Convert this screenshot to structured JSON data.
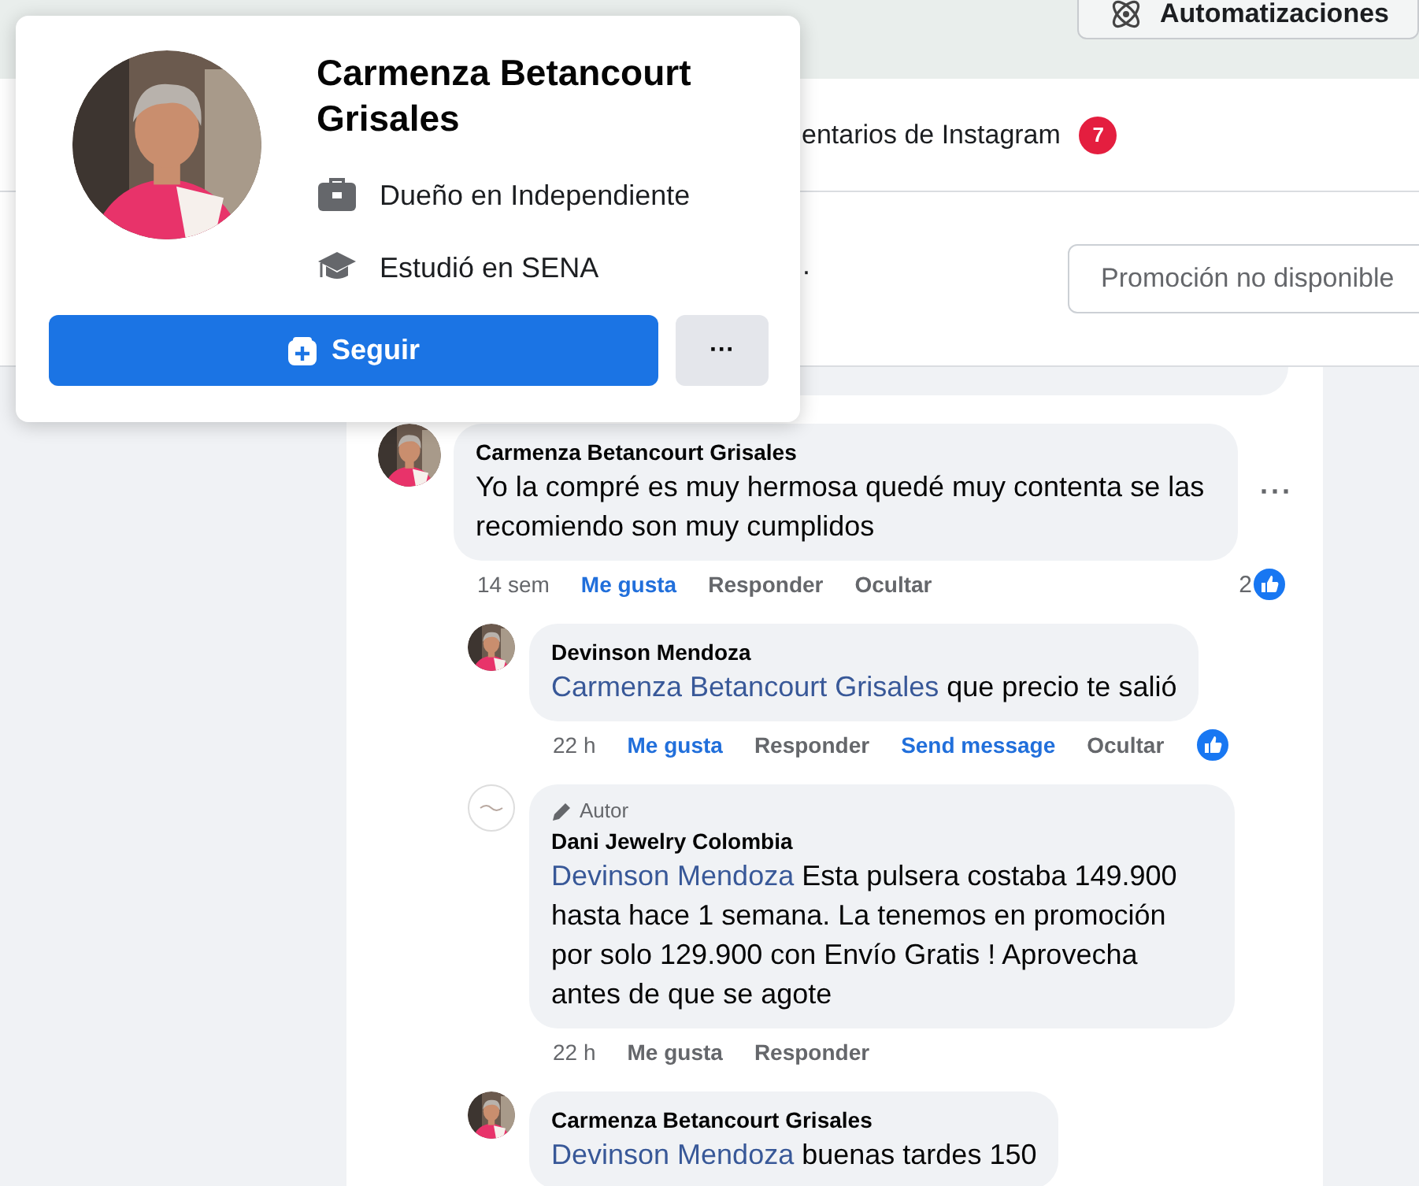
{
  "top_bar": {
    "buttons": [
      {
        "label": "Automatizaciones"
      }
    ]
  },
  "tabs": [
    {
      "label": "entarios de Instagram",
      "badge": "7"
    }
  ],
  "header": {
    "separator": "·",
    "promo_button": "Promoción no disponible"
  },
  "comments": [
    {
      "author": "Carmenza Betancourt Grisales",
      "text": "Yo la compré es muy hermosa quedé muy contenta se las recomiendo son muy cumplidos",
      "time": "14 sem",
      "more": "···",
      "reacted": true,
      "reaction_count": "2",
      "actions": [
        {
          "label": "Me gusta",
          "highlighted": true
        },
        {
          "label": "Responder",
          "highlighted": false
        },
        {
          "label": "Ocultar",
          "highlighted": false
        }
      ],
      "children": [
        {
          "author": "Devinson Mendoza",
          "mention": "Carmenza Betancourt Grisales",
          "text": "que precio te salió",
          "time": "22 h",
          "reacted": true,
          "actions": [
            {
              "label": "Me gusta",
              "highlighted": true
            },
            {
              "label": "Responder",
              "highlighted": false
            },
            {
              "label": "Send message",
              "highlighted": true
            },
            {
              "label": "Ocultar",
              "highlighted": false
            }
          ]
        },
        {
          "author": "Dani Jewelry Colombia",
          "badge": "Autor",
          "mention": "Devinson Mendoza",
          "text": "Esta pulsera costaba 149.900 hasta hace 1 semana. La tenemos en promoción por solo 129.900 con Envío Gratis ! Aprovecha antes de que se agote",
          "time": "22 h",
          "reacted": false,
          "actions": [
            {
              "label": "Me gusta",
              "highlighted": false
            },
            {
              "label": "Responder",
              "highlighted": false
            }
          ]
        },
        {
          "author": "Carmenza Betancourt Grisales",
          "mention": "Devinson Mendoza",
          "text": "buenas tardes 150"
        }
      ]
    }
  ],
  "profile_card": {
    "name": "Carmenza Betancourt Grisales",
    "details": [
      {
        "kind": "work",
        "text": "Dueño en Independiente"
      },
      {
        "kind": "education",
        "text": "Estudió en SENA"
      }
    ],
    "follow_button": "Seguir",
    "more_button": "···"
  }
}
